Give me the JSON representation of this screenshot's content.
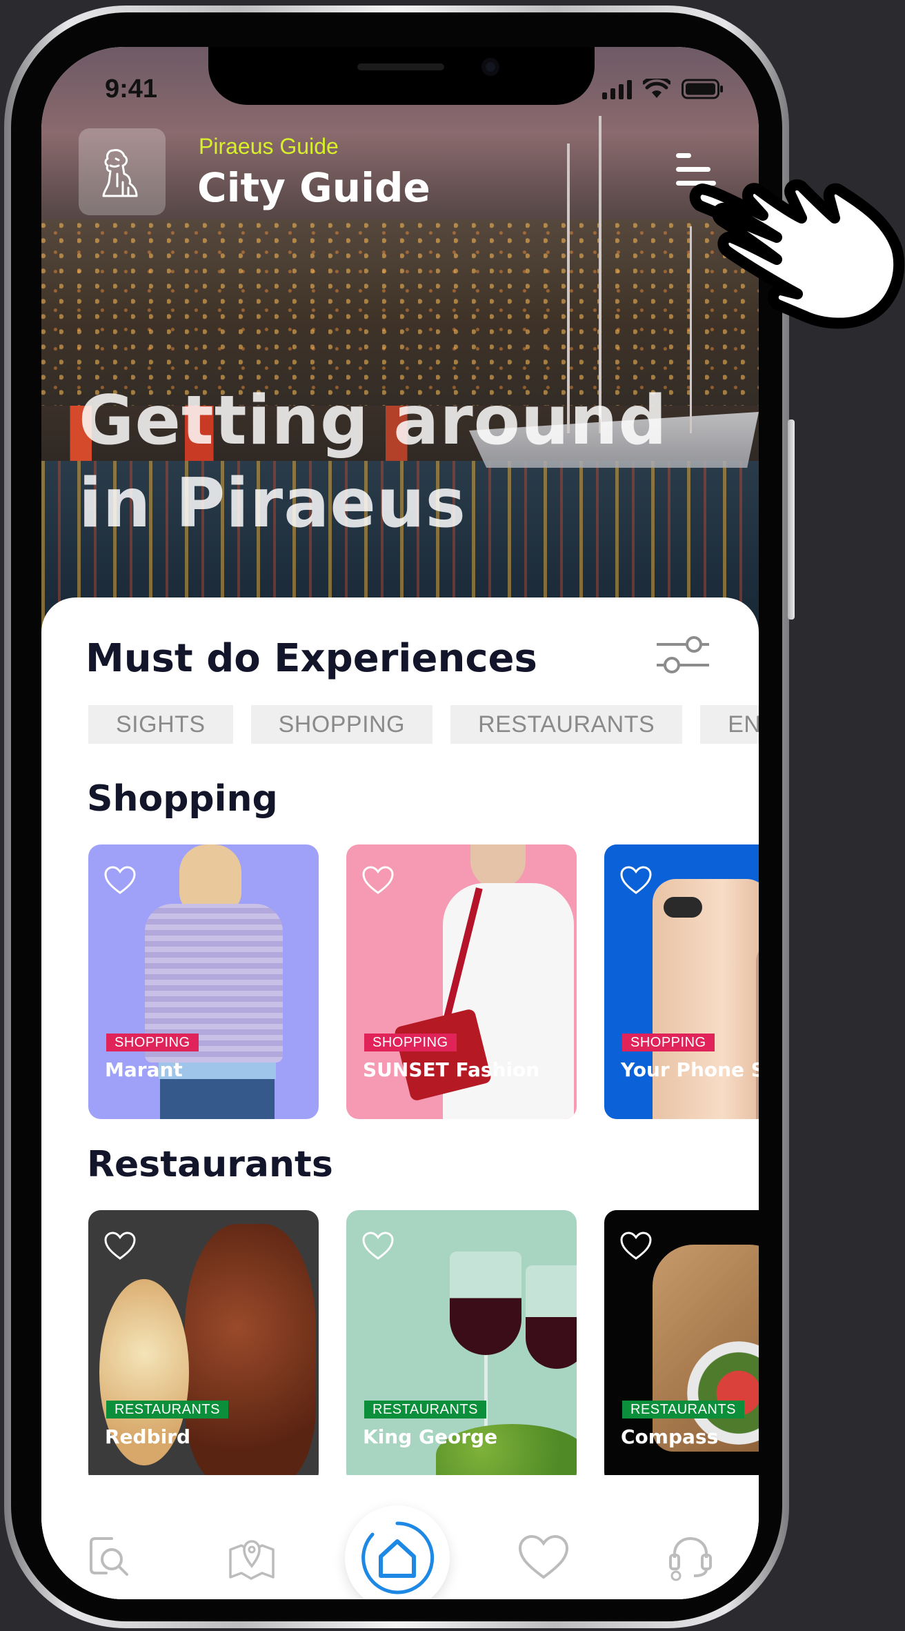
{
  "status_bar": {
    "time": "9:41"
  },
  "header": {
    "app_subtitle": "Piraeus Guide",
    "app_title": "City Guide"
  },
  "hero": {
    "title_line1": "Getting around",
    "title_line2": "in Piraeus"
  },
  "experiences": {
    "title": "Must do Experiences",
    "chips": [
      "SIGHTS",
      "SHOPPING",
      "RESTAURANTS",
      "ENTERTAINMENT"
    ]
  },
  "shopping": {
    "title": "Shopping",
    "cards": [
      {
        "tag": "SHOPPING",
        "name": "Marant",
        "bg": "#9ea1f7"
      },
      {
        "tag": "SHOPPING",
        "name": "SUNSET Fashion",
        "bg": "#f59ab2"
      },
      {
        "tag": "SHOPPING",
        "name": "Your Phone Shop",
        "bg": "#0a61d8"
      }
    ]
  },
  "restaurants": {
    "title": "Restaurants",
    "cards": [
      {
        "tag": "RESTAURANTS",
        "name": "Redbird",
        "bg": "#3b3b3b"
      },
      {
        "tag": "RESTAURANTS",
        "name": "King George",
        "bg": "#a8d4c2"
      },
      {
        "tag": "RESTAURANTS",
        "name": "Compass",
        "bg": "#050505"
      }
    ]
  },
  "colors": {
    "accent_lime": "#d8ef2b",
    "home_blue": "#1e88e5",
    "shopping_tag": "#e0245a",
    "restaurants_tag": "#0b8f3a"
  },
  "icons": {
    "logo": "lion-statue-icon",
    "menu": "menu-icon",
    "filter": "sliders-icon",
    "favorite": "heart-icon",
    "nav_search": "search-icon",
    "nav_map": "map-pin-icon",
    "nav_home": "home-icon",
    "nav_favorites": "heart-icon",
    "nav_support": "headset-icon",
    "cursor": "hand-pointer-icon"
  }
}
